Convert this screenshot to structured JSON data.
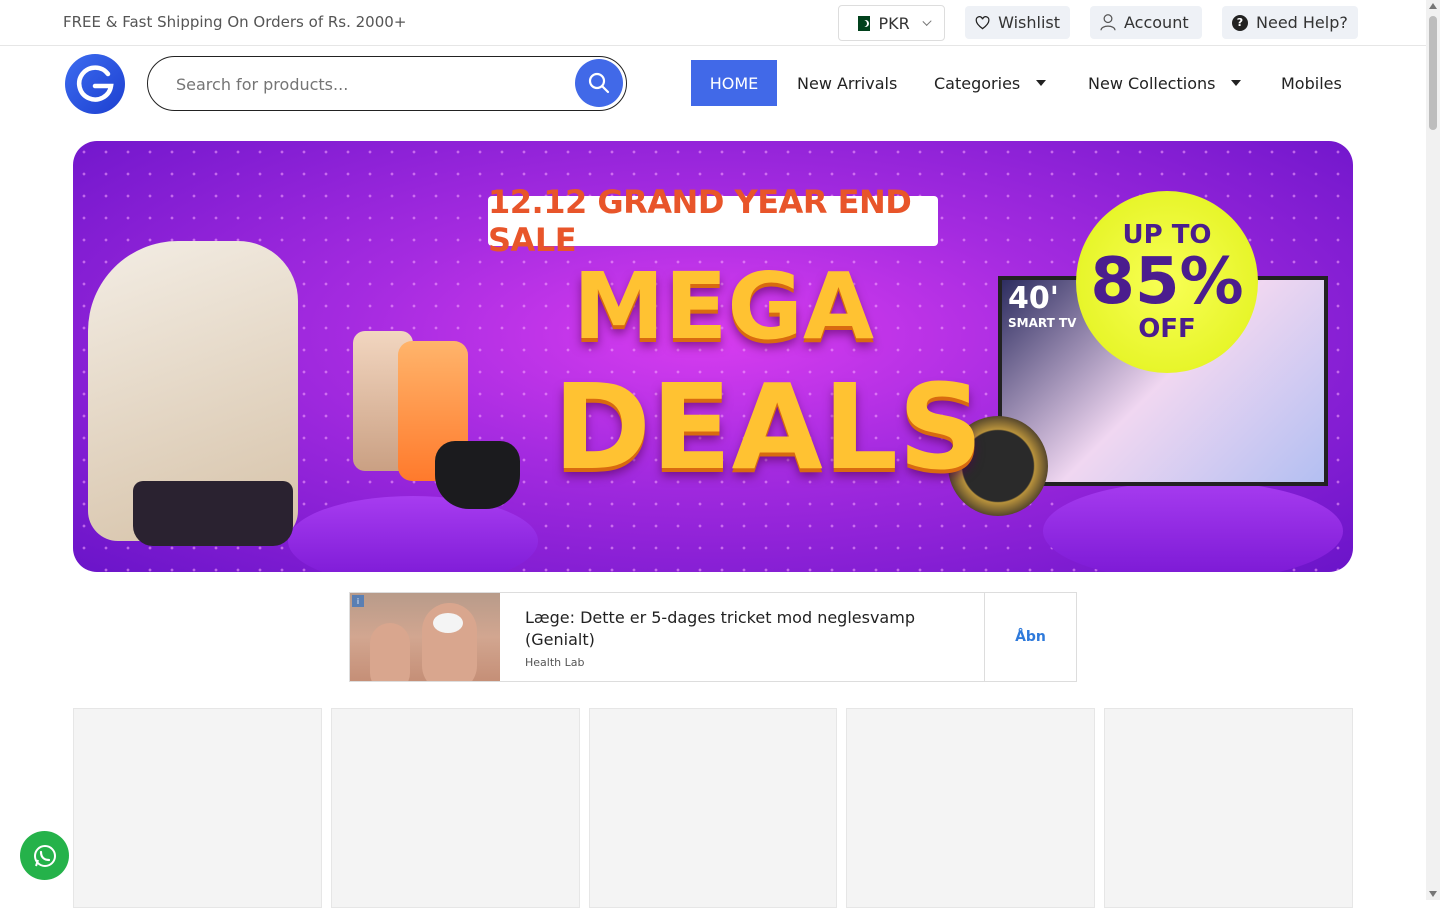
{
  "topbar": {
    "shipping_text": "FREE & Fast Shipping On Orders of Rs. 2000+",
    "currency": "PKR",
    "wishlist": "Wishlist",
    "account": "Account",
    "help": "Need Help?"
  },
  "header": {
    "search_placeholder": "Search for products...",
    "nav": {
      "home": "HOME",
      "new_arrivals": "New Arrivals",
      "categories": "Categories",
      "new_collections": "New Collections",
      "mobiles": "Mobiles"
    }
  },
  "banner": {
    "strip": "12.12 GRAND YEAR END SALE",
    "line1": "MEGA",
    "line2": "DEALS",
    "off_top": "UP TO",
    "off_pct": "85%",
    "off_bot": "OFF",
    "tv_size": "40'",
    "tv_sub": "SMART TV"
  },
  "ad": {
    "title": "Læge: Dette er 5-dages tricket mod neglesvamp (Genialt)",
    "source": "Health Lab",
    "cta": "Åbn"
  },
  "colors": {
    "accent": "#4169e8",
    "whatsapp": "#25b24a"
  }
}
